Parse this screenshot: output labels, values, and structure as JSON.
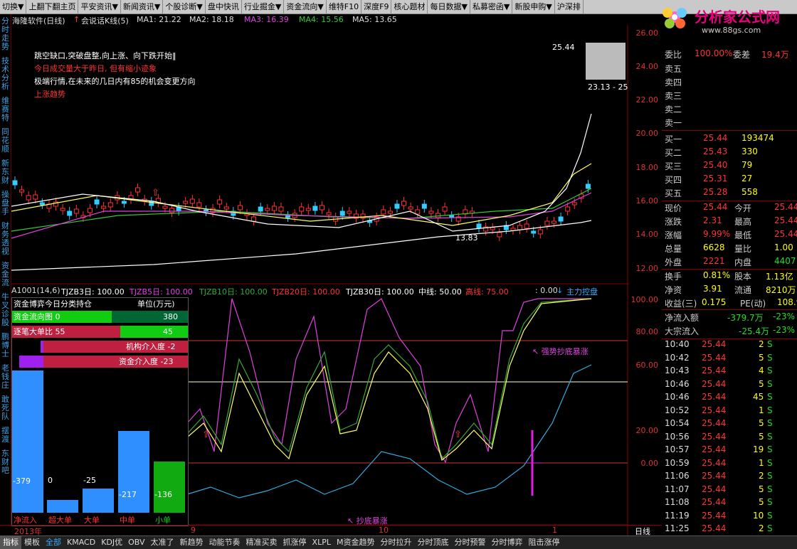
{
  "menu": [
    "切换▼",
    "上翻下翻主页",
    "平安资讯▼",
    "新闻资讯▼",
    "个股诊断▼",
    "盘中快讯",
    "行业掘金▼",
    "资金流向▼",
    "维特F10",
    "深度F9",
    "核心题材",
    "每日数据▼",
    "私募密函▼",
    "新股申购▼",
    "沪深排"
  ],
  "left_nav": [
    "分时走势",
    "技术分析",
    "维赛特",
    "同花顺",
    "新东财",
    "操盘手",
    "财务透视",
    "资金流",
    "牛叉诊股",
    "鹏博士",
    "老钱庄",
    "敢死队",
    "摆渡",
    "东财吧"
  ],
  "header": {
    "title": "海隆软件(日线)",
    "indicator": "会说话K线(5)",
    "ma1": "MA1: 21.22",
    "ma2": "MA2: 18.18",
    "ma3": "MA3: 16.39",
    "ma4": "MA4: 15.56",
    "ma5": "MA5: 13.65"
  },
  "notes": [
    "跳空缺口,突破盘整,向上涨、向下跌开始‖",
    "今日成交量大于昨日, 但有缩小迹象",
    "极端行情,在未来的几日内有85的机会变更方向",
    "上涨趋势"
  ],
  "price_labels": [
    "26.00",
    "24.00",
    "22.00",
    "20.00",
    "18.00",
    "16.00",
    "14.00",
    "12.00"
  ],
  "inset": {
    "top": "25.44",
    "bottom": "23.13 - 25"
  },
  "low_marker": "13.83",
  "quote": {
    "header_left": "委比",
    "header_val": "100.00%",
    "header_right": "委差",
    "header_right_val": "19.4万",
    "sell": [
      {
        "label": "卖五"
      },
      {
        "label": "卖四"
      },
      {
        "label": "卖三"
      },
      {
        "label": "卖二"
      },
      {
        "label": "卖一"
      }
    ],
    "buy": [
      {
        "label": "买一",
        "price": "25.44",
        "vol": "193474"
      },
      {
        "label": "买二",
        "price": "25.43",
        "vol": "330"
      },
      {
        "label": "买三",
        "price": "25.40",
        "vol": "79"
      },
      {
        "label": "买四",
        "price": "25.31",
        "vol": "27"
      },
      {
        "label": "买五",
        "price": "25.28",
        "vol": "558"
      }
    ],
    "stats": [
      {
        "l1": "现价",
        "v1": "25.44",
        "l2": "今开",
        "v2": "25.44"
      },
      {
        "l1": "涨跌",
        "v1": "2.31",
        "l2": "最高",
        "v2": "25.44"
      },
      {
        "l1": "涨幅",
        "v1": "9.99%",
        "l2": "最低",
        "v2": "25.44"
      },
      {
        "l1": "总量",
        "v1": "6628",
        "l2": "量比",
        "v2": "1.00"
      },
      {
        "l1": "外盘",
        "v1": "2221",
        "l2": "内盘",
        "v2": "4407"
      }
    ],
    "stats2": [
      {
        "l1": "换手",
        "v1": "0.81%",
        "l2": "股本",
        "v2": "1.13亿"
      },
      {
        "l1": "净资",
        "v1": "3.91",
        "l2": "流通",
        "v2": "8210万"
      },
      {
        "l1": "收益(三)",
        "v1": "0.175",
        "l2": "PE(动)",
        "v2": "108.9"
      }
    ],
    "flow1": {
      "label": "净流入额",
      "value": "-379.7万",
      "pct": "-23%"
    },
    "flow2": {
      "label": "大宗流入",
      "value": "-25.4万",
      "pct": "-23%"
    },
    "ticks": [
      {
        "t": "10:40",
        "p": "25.44",
        "v": "2",
        "s": "S"
      },
      {
        "t": "10:42",
        "p": "25.44",
        "v": "5",
        "s": "S"
      },
      {
        "t": "10:43",
        "p": "25.44",
        "v": "4",
        "s": "S"
      },
      {
        "t": "10:46",
        "p": "25.44",
        "v": "5",
        "s": "S"
      },
      {
        "t": "10:46",
        "p": "25.44",
        "v": "45",
        "s": "S"
      },
      {
        "t": "10:52",
        "p": "25.44",
        "v": "1",
        "s": "S"
      },
      {
        "t": "10:54",
        "p": "25.44",
        "v": "5",
        "s": "S"
      },
      {
        "t": "10:56",
        "p": "25.44",
        "v": "5",
        "s": "S"
      },
      {
        "t": "10:57",
        "p": "25.44",
        "v": "19",
        "s": "S"
      },
      {
        "t": "10:59",
        "p": "25.44",
        "v": "1",
        "s": "S"
      },
      {
        "t": "11:06",
        "p": "25.44",
        "v": "2",
        "s": "S"
      },
      {
        "t": "11:07",
        "p": "25.44",
        "v": "5",
        "s": "S"
      },
      {
        "t": "11:08",
        "p": "25.44",
        "v": "5",
        "s": "S"
      },
      {
        "t": "11:19",
        "p": "25.44",
        "v": "10",
        "s": "S"
      },
      {
        "t": "11:25",
        "p": "25.44",
        "v": "2",
        "s": "S"
      },
      {
        "t": "11:27",
        "p": "25.44",
        "v": "1",
        "s": "S"
      }
    ]
  },
  "indicator2": {
    "name": "A1001(14,6)",
    "tj3": "TJZB3日: 100.00",
    "tj5": "TJZB5日: 100.00",
    "tj10": "TJZB10日: 100.00",
    "tj20": "TJZB20日: 100.00",
    "tj30": "TJZB30日: 100.00",
    "mid": "中线: 50.00",
    "high": "高线: 75.00",
    "zero": ": 0.00",
    "tag": "主力控盘",
    "scale": [
      "100.00",
      "80.00",
      "60.00",
      "40.00",
      "20.00",
      "0.00"
    ],
    "strong_label": "↖ 强势抄底暴涨",
    "bottom_label": "↖ 抄底暴涨"
  },
  "fund": {
    "title": "资金博弈今日分类持仓",
    "unit": "单位(万元)",
    "r1_label": "资金流向图 0",
    "r1_val": "380",
    "r2_label": "逐笔大单比 55",
    "r2_val": "45",
    "r3_label": "机构介入度 -2",
    "r4_label": "资金介入度 -23",
    "bars": [
      {
        "label": "净流入",
        "value": -379,
        "text": "-379"
      },
      {
        "label": "超大单",
        "value": 0,
        "text": "0"
      },
      {
        "label": "大单",
        "value": -25,
        "text": "-25"
      },
      {
        "label": "中单",
        "value": -217,
        "text": "-217"
      },
      {
        "label": "小单",
        "value": -136,
        "text": "-136"
      }
    ]
  },
  "xaxis": {
    "year": "2013年",
    "m9": "9",
    "m10": "10",
    "m11": "1",
    "period": "日线"
  },
  "tabs": [
    "指标",
    "模板",
    "全部",
    "KMACD",
    "KDJ优",
    "OBV",
    "太准了",
    "新趋势",
    "动能节奏",
    "精准买卖",
    "抓涨停",
    "XLPL",
    "M资金趋势",
    "分时拉升",
    "分时顶底",
    "分时预警",
    "分时博弈",
    "阻击涨停"
  ],
  "logo": {
    "text": "分析家公式网",
    "url": "www.88gs.com"
  }
}
